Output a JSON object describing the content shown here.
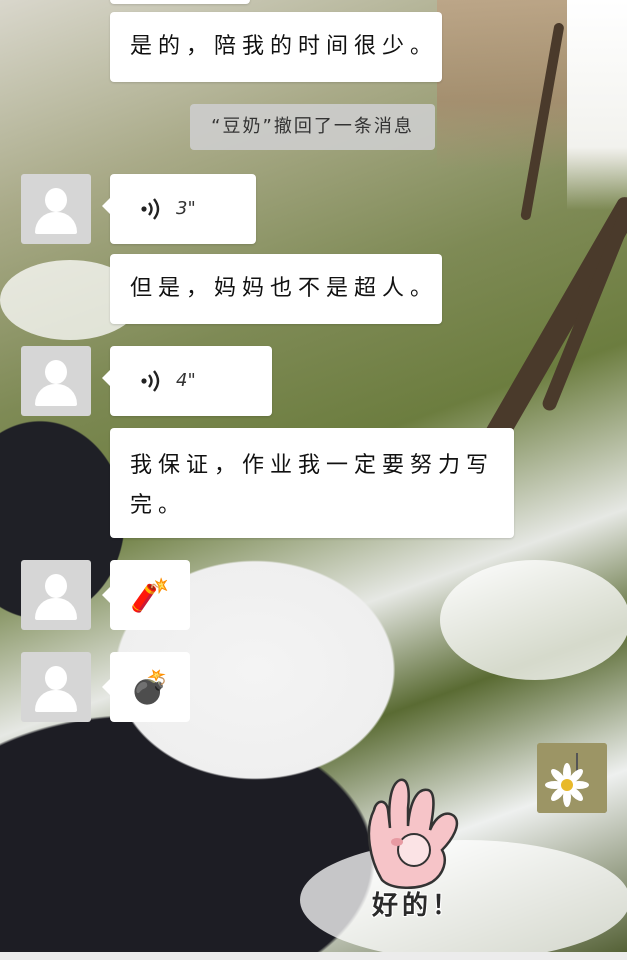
{
  "messages": {
    "m1_text": "是的，陪我的时间很少。",
    "recall_notice": "“豆奶”撤回了一条消息",
    "voice1_duration": "3\"",
    "m2_text": "但是，妈妈也不是超人。",
    "voice2_duration": "4\"",
    "m3_text": "我保证，作业我一定要努力写完。",
    "emoji1": "🧨",
    "emoji2": "💣",
    "sticker_caption": "好的！"
  },
  "icons": {
    "voice": "voice-wave-icon",
    "avatar_placeholder": "default-avatar-icon",
    "sticker": "ok-hand-sticker"
  },
  "colors": {
    "bubble": "#ffffff",
    "system_notice_bg": "#cdcdcd",
    "avatar_placeholder": "#d6d6d6"
  }
}
